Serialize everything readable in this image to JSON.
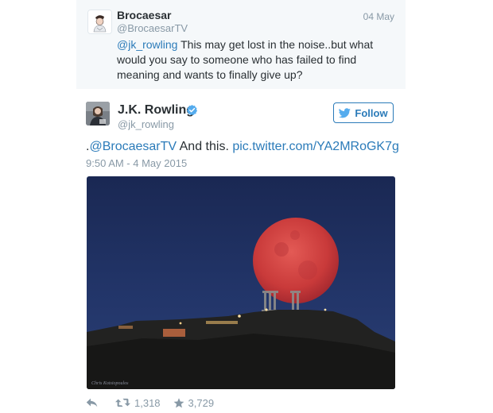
{
  "reply_tweet": {
    "name": "Brocaesar",
    "handle": "@BrocaesarTV",
    "date": "04 May",
    "mention": "@jk_rowling",
    "text": " This may get lost in the noise..but what would you say to someone who has failed to find meaning and wants to finally give up?"
  },
  "main_tweet": {
    "name": "J.K. Rowling",
    "handle": "@jk_rowling",
    "follow_label": "Follow",
    "text_prefix": ".",
    "mention": "@BrocaesarTV",
    "text_body": " And this. ",
    "link": "pic.twitter.com/YA2MRoGK7g",
    "timestamp": "9:50 AM - 4 May 2015",
    "photo_credit": "Chris Kotsiopoulos",
    "retweet_count": "1,318",
    "favorite_count": "3,729"
  },
  "icons": {
    "verified": "verified-badge-icon",
    "follow": "twitter-bird-icon",
    "reply": "reply-arrow-icon",
    "retweet": "retweet-icon",
    "favorite": "star-icon"
  },
  "colors": {
    "link_blue": "#2b7bb9",
    "verified_blue": "#55acee",
    "muted_gray": "#8899a6",
    "text_dark": "#292f33",
    "reply_background": "#f5f8fa",
    "moon": "#c93a3a",
    "sky": "#1f2f60"
  }
}
